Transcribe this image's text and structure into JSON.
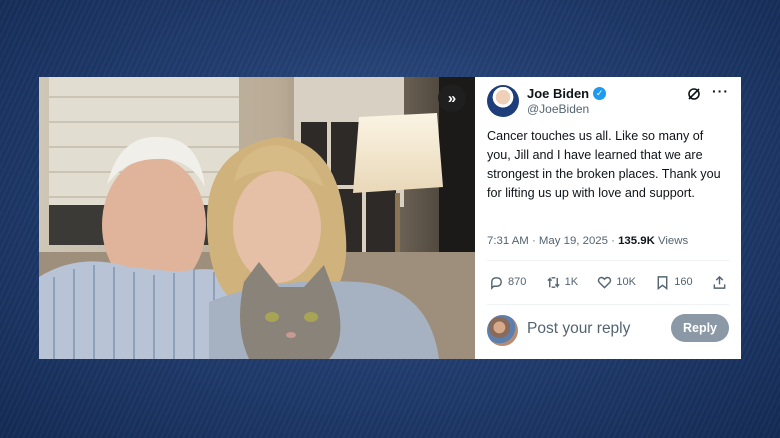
{
  "photo": {
    "description_icon": "photo-image"
  },
  "expand": {
    "icon": "double-chevron-right-icon",
    "label": "»"
  },
  "tweet": {
    "author": {
      "display_name": "Joe Biden",
      "handle": "@JoeBiden",
      "verified": true,
      "verified_mark": "✓"
    },
    "header_icons": {
      "grok": "grok-icon",
      "more": "···"
    },
    "text": "Cancer touches us all. Like so many of you, Jill and I have learned that we are strongest in the broken places. Thank you for lifting us up with love and support.",
    "time": "7:31 AM",
    "separator": " · ",
    "date": "May 19, 2025",
    "views_count": "135.9K",
    "views_label": " Views",
    "actions": {
      "replies": "870",
      "reposts": "1K",
      "likes": "10K",
      "bookmarks": "160"
    }
  },
  "reply_box": {
    "placeholder": "Post your reply",
    "button_label": "Reply"
  },
  "colors": {
    "background": "#233f72",
    "text_primary": "#0f1419",
    "text_secondary": "#536471",
    "verified_blue": "#1d9bf0",
    "reply_button": "#8b98a5"
  }
}
